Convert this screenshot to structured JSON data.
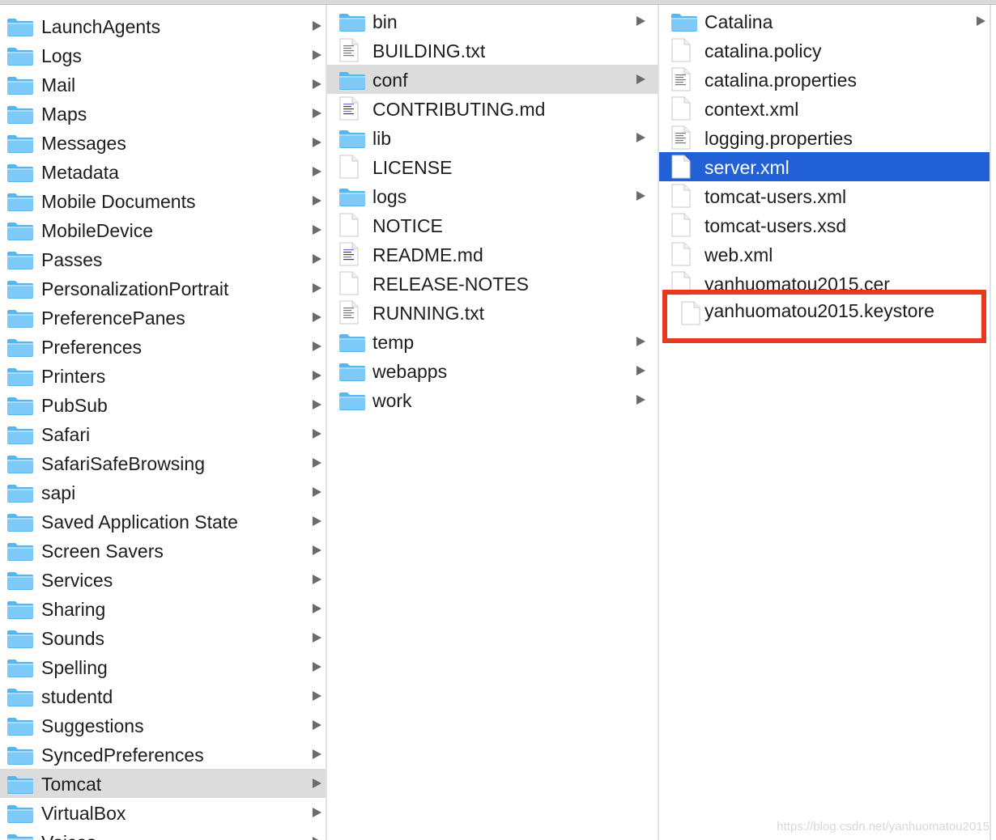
{
  "window": {
    "title": ""
  },
  "columns": {
    "library": {
      "selected_index": 26,
      "items": [
        {
          "label": "LaunchAgents",
          "type": "folder"
        },
        {
          "label": "Logs",
          "type": "folder"
        },
        {
          "label": "Mail",
          "type": "folder"
        },
        {
          "label": "Maps",
          "type": "folder"
        },
        {
          "label": "Messages",
          "type": "folder"
        },
        {
          "label": "Metadata",
          "type": "folder"
        },
        {
          "label": "Mobile Documents",
          "type": "folder"
        },
        {
          "label": "MobileDevice",
          "type": "folder"
        },
        {
          "label": "Passes",
          "type": "folder"
        },
        {
          "label": "PersonalizationPortrait",
          "type": "folder"
        },
        {
          "label": "PreferencePanes",
          "type": "folder"
        },
        {
          "label": "Preferences",
          "type": "folder"
        },
        {
          "label": "Printers",
          "type": "folder"
        },
        {
          "label": "PubSub",
          "type": "folder"
        },
        {
          "label": "Safari",
          "type": "folder"
        },
        {
          "label": "SafariSafeBrowsing",
          "type": "folder"
        },
        {
          "label": "sapi",
          "type": "folder"
        },
        {
          "label": "Saved Application State",
          "type": "folder"
        },
        {
          "label": "Screen Savers",
          "type": "folder"
        },
        {
          "label": "Services",
          "type": "folder"
        },
        {
          "label": "Sharing",
          "type": "folder"
        },
        {
          "label": "Sounds",
          "type": "folder"
        },
        {
          "label": "Spelling",
          "type": "folder"
        },
        {
          "label": "studentd",
          "type": "folder"
        },
        {
          "label": "Suggestions",
          "type": "folder"
        },
        {
          "label": "SyncedPreferences",
          "type": "folder"
        },
        {
          "label": "Tomcat",
          "type": "folder"
        },
        {
          "label": "VirtualBox",
          "type": "folder"
        },
        {
          "label": "Voices",
          "type": "folder"
        }
      ]
    },
    "tomcat": {
      "selected_index": 2,
      "items": [
        {
          "label": "bin",
          "type": "folder"
        },
        {
          "label": "BUILDING.txt",
          "type": "text"
        },
        {
          "label": "conf",
          "type": "folder"
        },
        {
          "label": "CONTRIBUTING.md",
          "type": "markdown"
        },
        {
          "label": "lib",
          "type": "folder"
        },
        {
          "label": "LICENSE",
          "type": "file"
        },
        {
          "label": "logs",
          "type": "folder"
        },
        {
          "label": "NOTICE",
          "type": "file"
        },
        {
          "label": "README.md",
          "type": "markdown"
        },
        {
          "label": "RELEASE-NOTES",
          "type": "file"
        },
        {
          "label": "RUNNING.txt",
          "type": "text"
        },
        {
          "label": "temp",
          "type": "folder"
        },
        {
          "label": "webapps",
          "type": "folder"
        },
        {
          "label": "work",
          "type": "folder"
        }
      ]
    },
    "conf": {
      "selected_index": 5,
      "items": [
        {
          "label": "Catalina",
          "type": "folder"
        },
        {
          "label": "catalina.policy",
          "type": "file"
        },
        {
          "label": "catalina.properties",
          "type": "text"
        },
        {
          "label": "context.xml",
          "type": "file"
        },
        {
          "label": "logging.properties",
          "type": "text"
        },
        {
          "label": "server.xml",
          "type": "file"
        },
        {
          "label": "tomcat-users.xml",
          "type": "file"
        },
        {
          "label": "tomcat-users.xsd",
          "type": "file"
        },
        {
          "label": "web.xml",
          "type": "file"
        },
        {
          "label": "yanhuomatou2015.cer",
          "type": "file"
        },
        {
          "label": "yanhuomatou2015.keystore",
          "type": "file"
        }
      ]
    }
  },
  "highlight": {
    "label_index": 10,
    "color": "#e7391f"
  },
  "colors": {
    "selection_blue": "#2160d6",
    "selection_gray": "#dcdcdc",
    "folder": "#6cc3f5"
  },
  "watermark": "https://blog.csdn.net/yanhuomatou2015"
}
